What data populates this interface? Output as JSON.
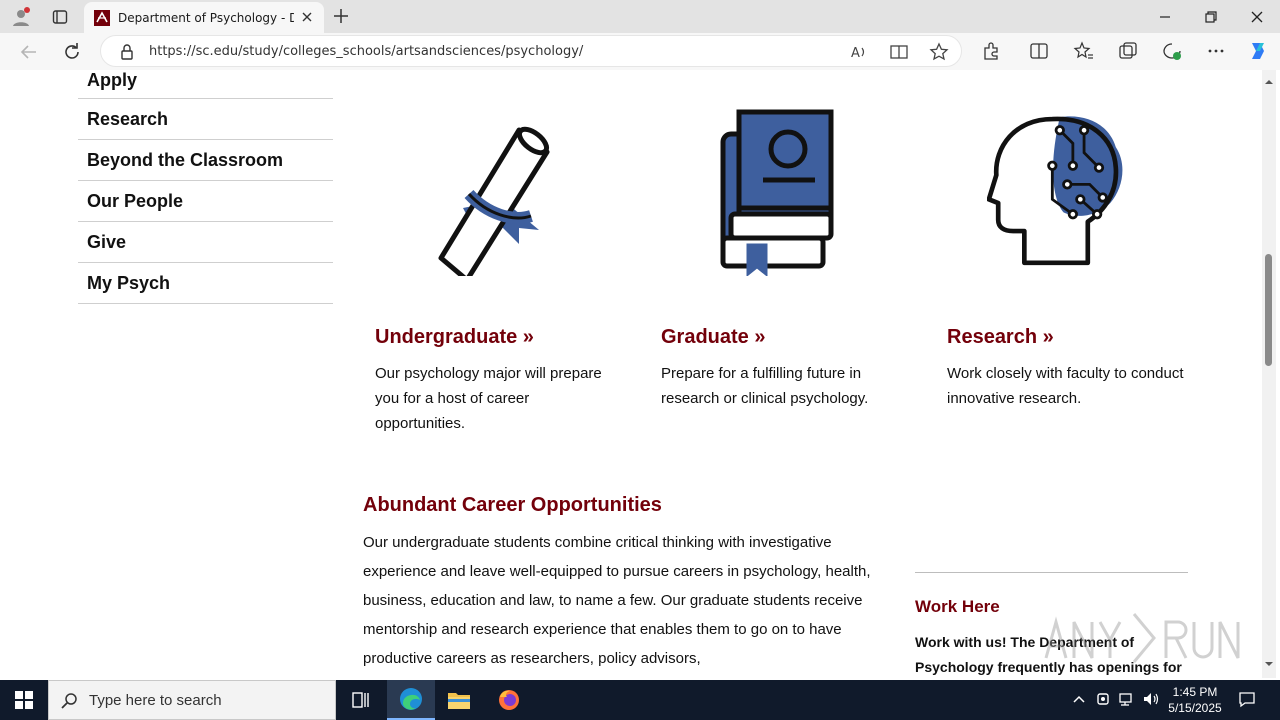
{
  "browser": {
    "tab_title": "Department of Psychology - Dep",
    "url": "https://sc.edu/study/colleges_schools/artsandsciences/psychology/"
  },
  "sidenav": {
    "items": [
      "Apply",
      "Research",
      "Beyond the Classroom",
      "Our People",
      "Give",
      "My Psych"
    ]
  },
  "features": [
    {
      "title": "Undergraduate »",
      "text": "Our psychology major will prepare you for a host of career opportunities.",
      "icon": "diploma-icon"
    },
    {
      "title": "Graduate »",
      "text": "Prepare for a fulfilling future in research or clinical psychology.",
      "icon": "books-icon"
    },
    {
      "title": "Research »",
      "text": "Work closely with faculty to conduct innovative research.",
      "icon": "brain-circuit-icon"
    }
  ],
  "career": {
    "title": "Abundant Career Opportunities",
    "body": "Our undergraduate students combine critical thinking with investigative experience and leave well-equipped to pursue careers in psychology, health, business, education and law, to name a few. Our graduate students receive mentorship and research experience that enables them to go on to have productive careers as researchers, policy advisors,"
  },
  "work": {
    "title": "Work Here",
    "body": "Work with us! The Department of Psychology frequently has openings for"
  },
  "taskbar": {
    "search_placeholder": "Type here to search",
    "time": "1:45 PM",
    "date": "5/15/2025"
  },
  "colors": {
    "garnet": "#73000a",
    "icon_blue": "#3e5f9e"
  }
}
